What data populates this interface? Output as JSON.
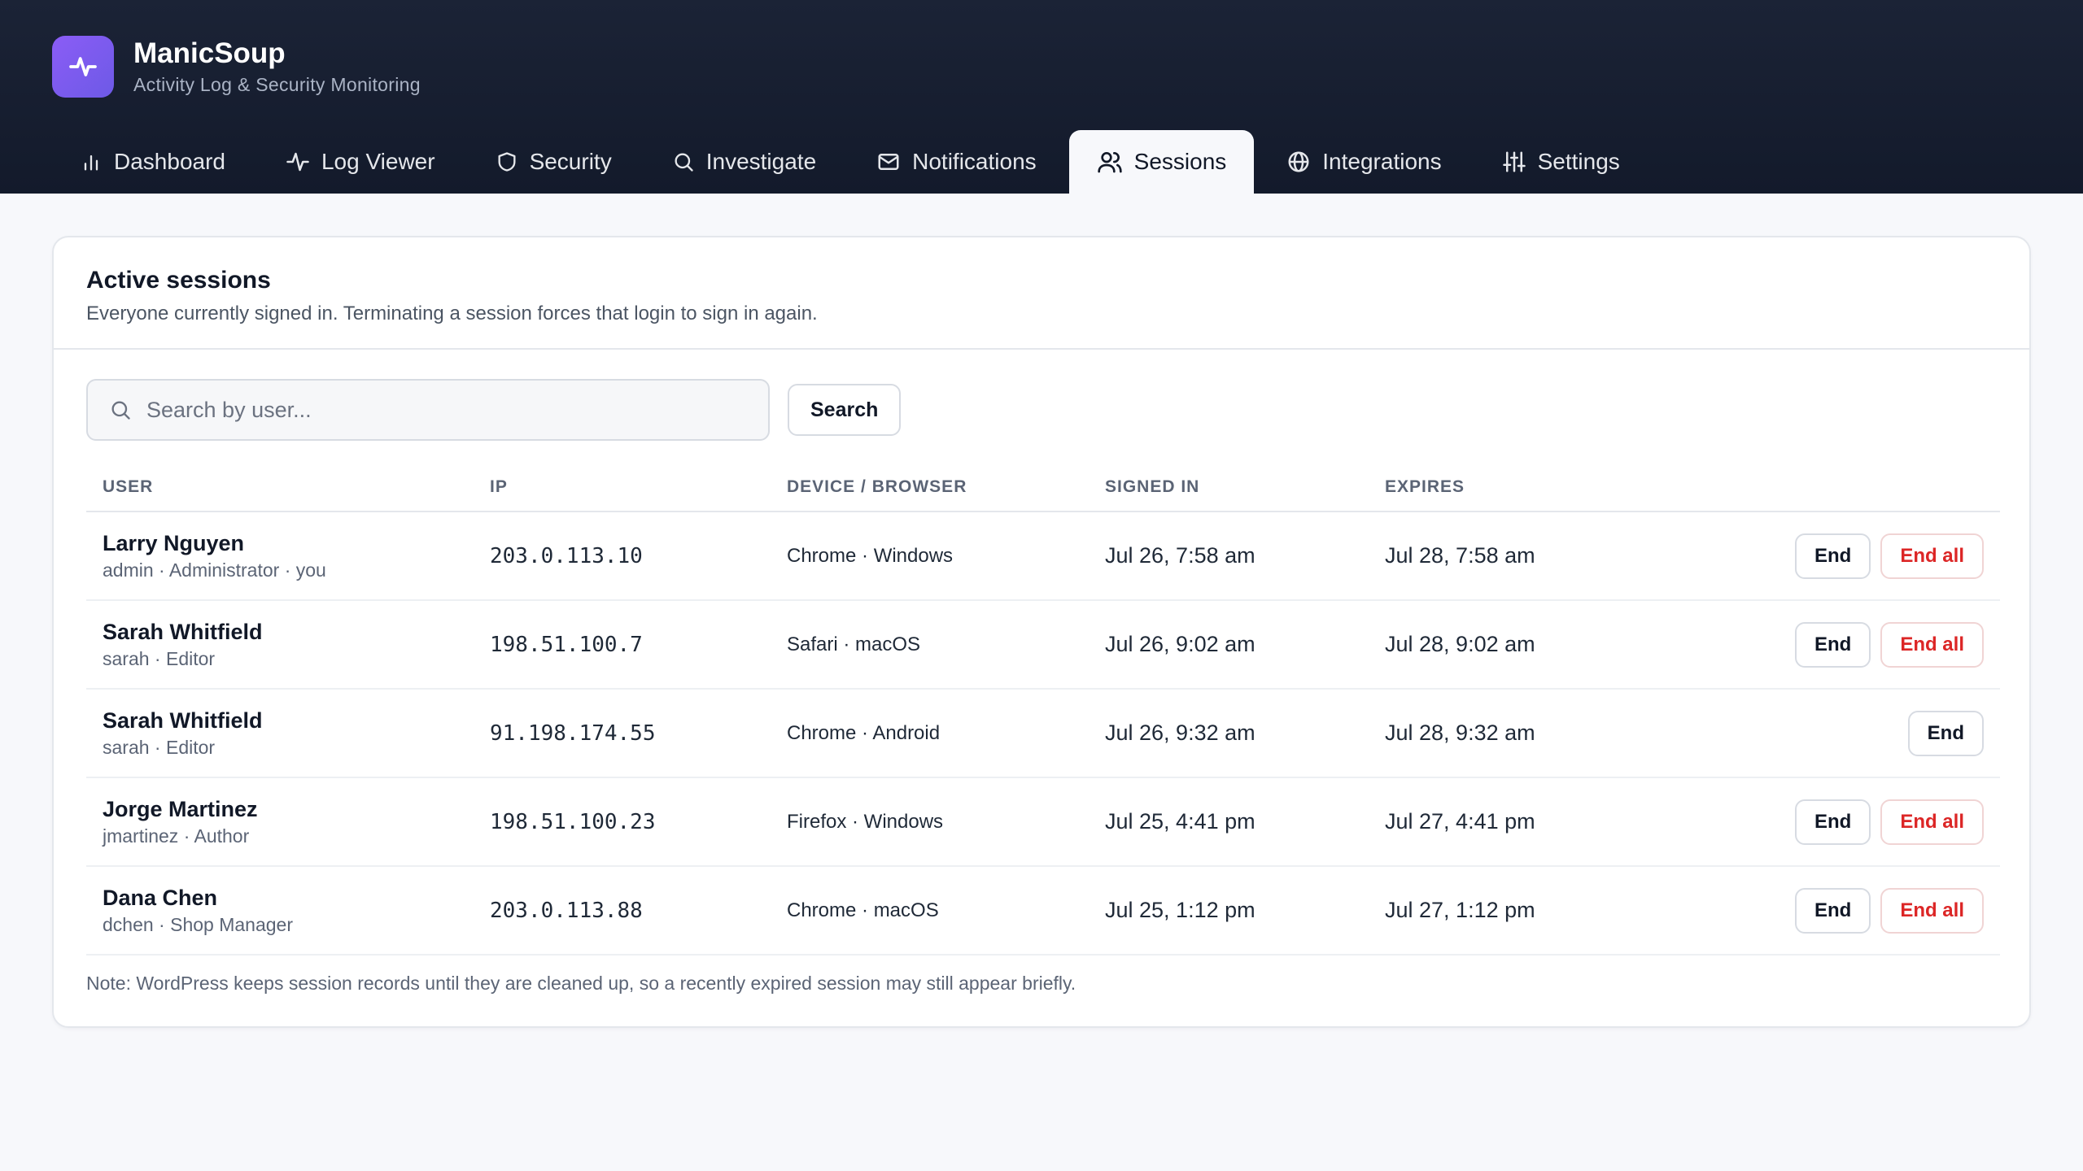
{
  "app": {
    "name": "ManicSoup",
    "subtitle": "Activity Log & Security Monitoring",
    "logo_icon": "pulse-icon",
    "accent": "#8b5cf6"
  },
  "tabs": [
    {
      "label": "Dashboard",
      "icon": "bar-chart-icon"
    },
    {
      "label": "Log Viewer",
      "icon": "pulse-icon"
    },
    {
      "label": "Security",
      "icon": "shield-icon"
    },
    {
      "label": "Investigate",
      "icon": "search-icon"
    },
    {
      "label": "Notifications",
      "icon": "mail-icon"
    },
    {
      "label": "Sessions",
      "icon": "users-icon",
      "active": true
    },
    {
      "label": "Integrations",
      "icon": "globe-icon"
    },
    {
      "label": "Settings",
      "icon": "sliders-icon"
    }
  ],
  "card": {
    "title": "Active sessions",
    "description": "Everyone currently signed in. Terminating a session forces that login to sign in again."
  },
  "search": {
    "placeholder": "Search by user...",
    "value": "",
    "button_label": "Search"
  },
  "table": {
    "headers": [
      "USER",
      "IP",
      "DEVICE / BROWSER",
      "SIGNED IN",
      "EXPIRES"
    ],
    "rows": [
      {
        "name": "Larry Nguyen",
        "meta": "admin · Administrator · you",
        "ip": "203.0.113.10",
        "device": "Chrome · Windows",
        "signed_in": "Jul 26, 7:58 am",
        "expires": "Jul 28, 7:58 am",
        "end": "End",
        "end_all": "End all"
      },
      {
        "name": "Sarah Whitfield",
        "meta": "sarah · Editor",
        "ip": "198.51.100.7",
        "device": "Safari · macOS",
        "signed_in": "Jul 26, 9:02 am",
        "expires": "Jul 28, 9:02 am",
        "end": "End",
        "end_all": "End all"
      },
      {
        "name": "Sarah Whitfield",
        "meta": "sarah · Editor",
        "ip": "91.198.174.55",
        "device": "Chrome · Android",
        "signed_in": "Jul 26, 9:32 am",
        "expires": "Jul 28, 9:32 am",
        "end": "End",
        "end_all": null
      },
      {
        "name": "Jorge Martinez",
        "meta": "jmartinez · Author",
        "ip": "198.51.100.23",
        "device": "Firefox · Windows",
        "signed_in": "Jul 25, 4:41 pm",
        "expires": "Jul 27, 4:41 pm",
        "end": "End",
        "end_all": "End all"
      },
      {
        "name": "Dana Chen",
        "meta": "dchen · Shop Manager",
        "ip": "203.0.113.88",
        "device": "Chrome · macOS",
        "signed_in": "Jul 25, 1:12 pm",
        "expires": "Jul 27, 1:12 pm",
        "end": "End",
        "end_all": "End all"
      }
    ]
  },
  "note": "Note: WordPress keeps session records until they are cleaned up, so a recently expired session may still appear briefly.",
  "colors": {
    "header_bg": "#131a2b",
    "danger": "#dc2626"
  }
}
